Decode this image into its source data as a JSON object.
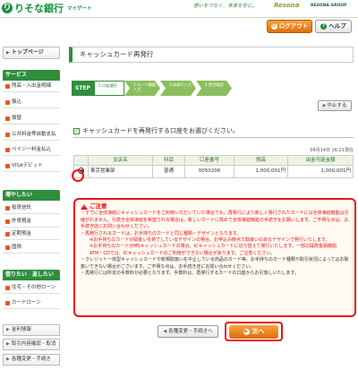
{
  "header": {
    "logo_text": "りそな銀行",
    "logo_sub": "マイゲート",
    "tagline": "想いをつなぐ、未来を形に。",
    "brand_2": "Resona",
    "brand_3": "RESONA GROUP",
    "logout_label": "ログアウト",
    "help_label": "ヘルプ"
  },
  "sidebar": {
    "top_label": "トップページ",
    "service_head": "サービス",
    "service_items": [
      "残高・入出金明細",
      "振込",
      "振替",
      "公共料金等自動支払",
      "ペイジー料金払込",
      "VISAデビット"
    ],
    "increase_head": "増やしたい",
    "increase_items": [
      "投資信託",
      "外貨預金",
      "定期預金",
      "国債"
    ],
    "borrow_head": "借りたい　返したい",
    "borrow_items": [
      "住宅・その他ローン",
      "カードローン"
    ],
    "bottom_items": [
      "金利情報",
      "取引内容確認・取消",
      "各種変更・手続き"
    ]
  },
  "main": {
    "title": "キャッシュカード再発行",
    "step_label": "STEP",
    "steps": [
      "1.口座選択",
      "2.カード種類入力",
      "3.再発行入力",
      "4.受付確認"
    ],
    "interrupt_label": "中止する",
    "instruction": "キャッシュカードを再発行する口座をお選びください。",
    "timestamp": "06月14日 16:21現在",
    "table": {
      "headers": [
        "",
        "支店名",
        "科目",
        "口座番号",
        "残高",
        "出金可能金額"
      ],
      "rows": [
        {
          "selected": true,
          "branch": "東京営業部",
          "type": "普通",
          "account": "0050206",
          "balance": "1,000,001円",
          "available": "1,000,001円"
        }
      ]
    },
    "notice": {
      "title": "ご注意",
      "lines": [
        "・すでに全体凍結にキャッシュカードをご利用いただいていた場合でも、再発行により新しく発行されたカードには全体凍結機能は引継がれません。引続き全体凍結を希望される場合は、新しいカードに改めて全体凍結機能の手続きをお願いします。ご不明な点は、お手続き店にお問い合わせください。",
        "・再発行されるカードは、お手持ちのカードと同じ種類・デザインとなります。",
        "※お手持ちのカードが取扱いを終了しているデザインの場合、お申込み時点で取扱いのあるデザインで発行いたします。",
        "※お手持ちのカードがMSキャッシュカードの場合、ICキャッシュカードに切り替えて発行いたします。一部の提携金融機関ATM・CDでは、ICキャッシュカードのご利用ができない場合があります。ご注意ください。",
        "・クレジット一体型キャッシュカードや新規取扱いを中止している商品のカード等、お手持ちのカード種類や取引状況によってはお取扱いできない場合がございます。ご不明な点は、お手続き店にお問い合わせください。",
        "・再発行には所定の手数料が必要となります。手数料は、再発行するカードの口座からお引落しいたします。"
      ]
    },
    "back_label": "各種変更・手続きへ",
    "next_label": "次へ"
  }
}
